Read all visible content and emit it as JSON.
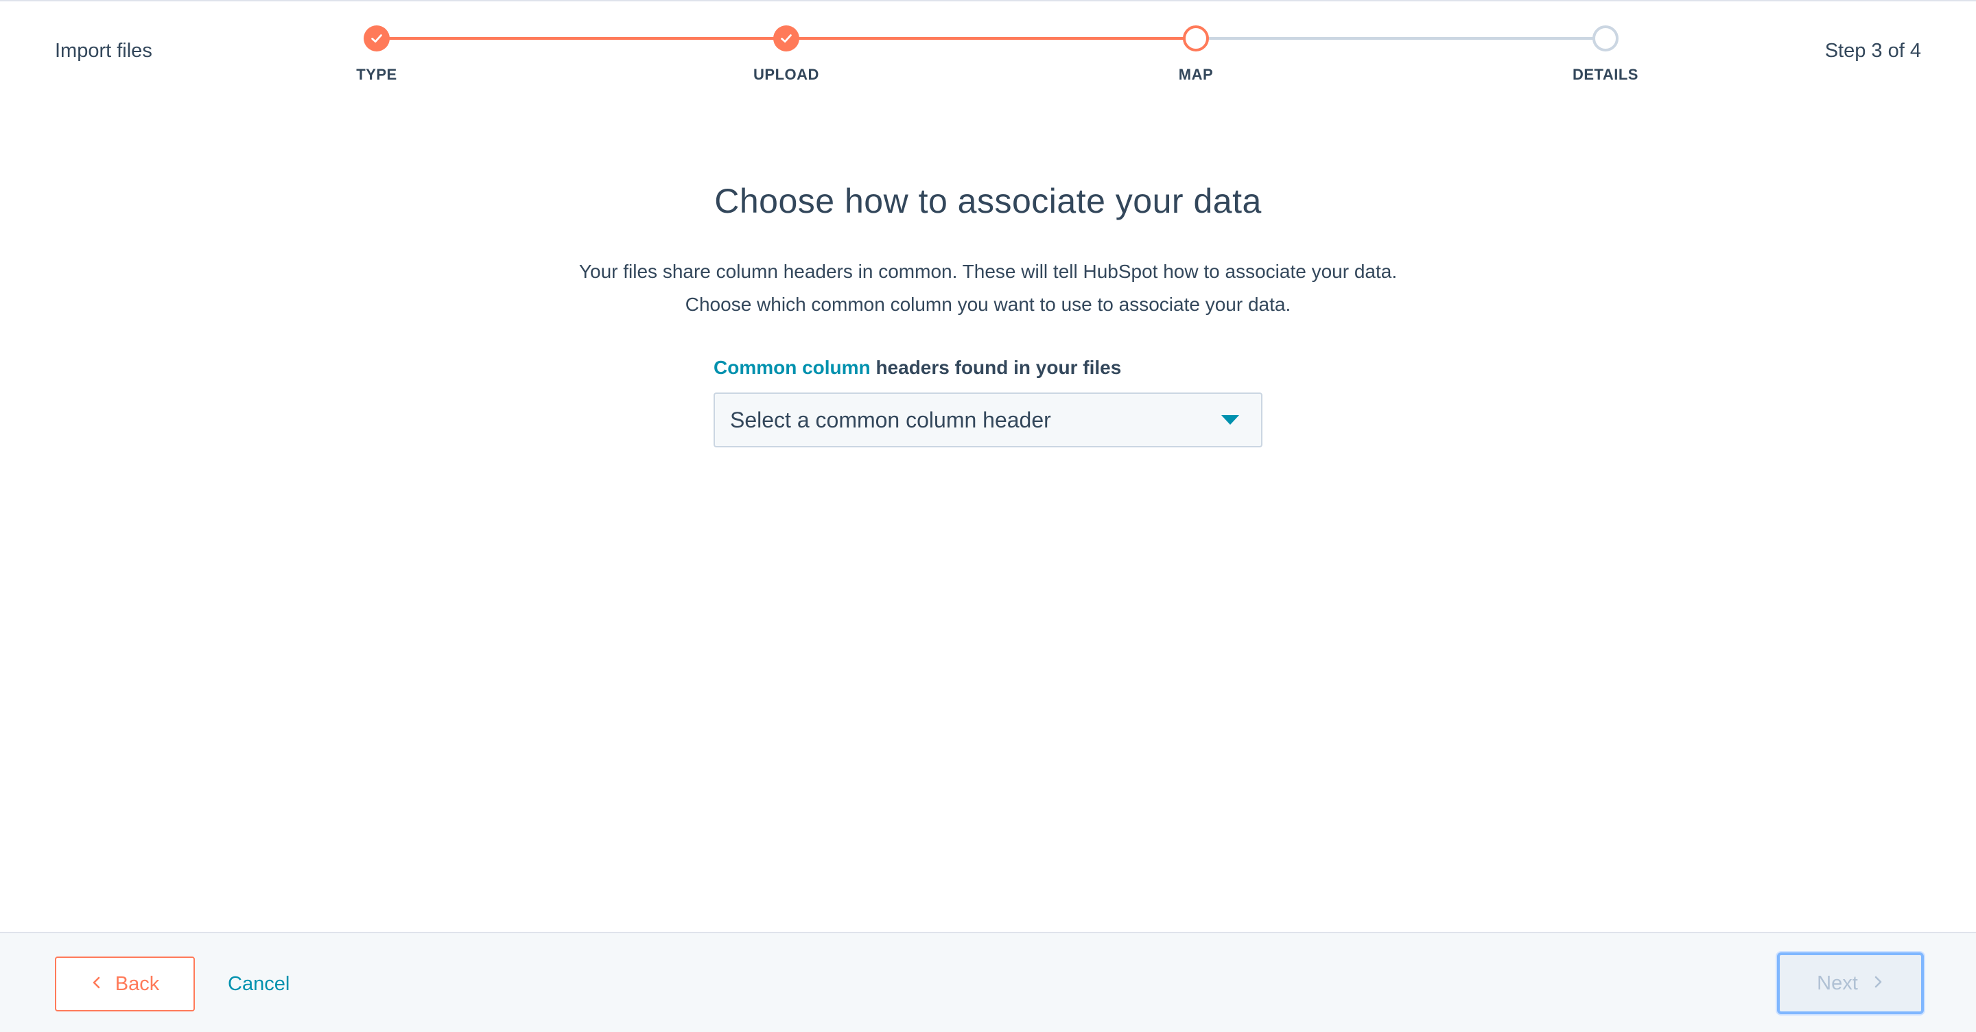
{
  "header": {
    "title": "Import files",
    "step_count": "Step 3 of 4"
  },
  "stepper": {
    "steps": [
      {
        "label": "TYPE",
        "state": "done"
      },
      {
        "label": "UPLOAD",
        "state": "done"
      },
      {
        "label": "MAP",
        "state": "active"
      },
      {
        "label": "DETAILS",
        "state": "pending"
      }
    ]
  },
  "main": {
    "heading": "Choose how to associate your data",
    "description": "Your files share column headers in common. These will tell HubSpot how to associate your data. Choose which common column you want to use to associate your data.",
    "field_label_link": "Common column",
    "field_label_rest": " headers found in your files",
    "select_placeholder": "Select a common column header"
  },
  "footer": {
    "back_label": "Back",
    "cancel_label": "Cancel",
    "next_label": "Next"
  },
  "colors": {
    "accent": "#ff7a59",
    "link": "#0091ae",
    "text": "#33475b",
    "pending": "#cbd6e2"
  }
}
